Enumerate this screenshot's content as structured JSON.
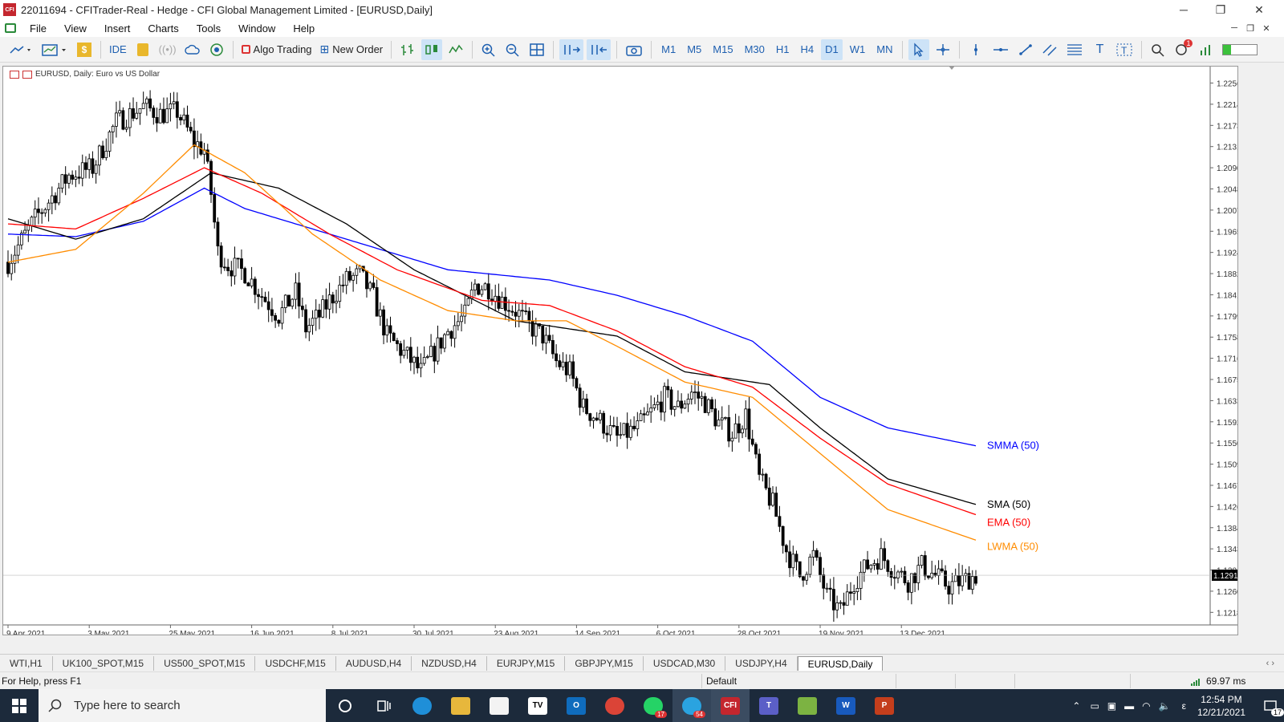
{
  "window": {
    "title": "22011694 - CFITrader-Real - Hedge - CFI Global Management Limited - [EURUSD,Daily]",
    "app_icon": "CFI",
    "controls": [
      "─",
      "❐",
      "✕"
    ]
  },
  "menu": [
    "File",
    "View",
    "Insert",
    "Charts",
    "Tools",
    "Window",
    "Help"
  ],
  "mdi_controls": [
    "─",
    "❐",
    "✕"
  ],
  "toolbar": {
    "ide": "IDE",
    "algo_trading": "Algo Trading",
    "new_order": "New Order",
    "timeframes": [
      "M1",
      "M5",
      "M15",
      "M30",
      "H1",
      "H4",
      "D1",
      "W1",
      "MN"
    ],
    "active_timeframe": "D1",
    "alert_count": "1"
  },
  "chart": {
    "header": "EURUSD, Daily:  Euro vs US Dollar",
    "price_labels": [
      "1.22560",
      "1.22145",
      "1.21730",
      "1.21315",
      "1.20900",
      "1.20485",
      "1.20070",
      "1.19655",
      "1.19240",
      "1.18825",
      "1.18410",
      "1.17995",
      "1.17580",
      "1.17165",
      "1.16750",
      "1.16335",
      "1.15920",
      "1.15505",
      "1.15090",
      "1.14675",
      "1.14260",
      "1.13845",
      "1.13430",
      "1.13015",
      "1.12600",
      "1.12185"
    ],
    "current_price": "1.12913",
    "date_labels": [
      "9 Apr 2021",
      "3 May 2021",
      "25 May 2021",
      "16 Jun 2021",
      "8 Jul 2021",
      "30 Jul 2021",
      "23 Aug 2021",
      "14 Sep 2021",
      "6 Oct 2021",
      "28 Oct 2021",
      "19 Nov 2021",
      "13 Dec 2021"
    ],
    "indicators": [
      {
        "label": "SMMA (50)",
        "color": "#0000ff"
      },
      {
        "label": "SMA (50)",
        "color": "#000000"
      },
      {
        "label": "EMA (50)",
        "color": "#ff0000"
      },
      {
        "label": "LWMA (50)",
        "color": "#ff8c00"
      }
    ]
  },
  "chart_data": {
    "type": "candlestick",
    "title": "EURUSD, Daily:  Euro vs US Dollar",
    "y_range": [
      1.1197,
      1.2282
    ],
    "x_ticks": [
      "9 Apr 2021",
      "3 May 2021",
      "25 May 2021",
      "16 Jun 2021",
      "8 Jul 2021",
      "30 Jul 2021",
      "23 Aug 2021",
      "14 Sep 2021",
      "6 Oct 2021",
      "28 Oct 2021",
      "19 Nov 2021",
      "13 Dec 2021"
    ],
    "close_path": [
      [
        0,
        1.1905
      ],
      [
        8,
        1.199
      ],
      [
        18,
        1.2075
      ],
      [
        25,
        1.209
      ],
      [
        32,
        1.218
      ],
      [
        40,
        1.221
      ],
      [
        45,
        1.2195
      ],
      [
        50,
        1.22
      ],
      [
        55,
        1.214
      ],
      [
        58,
        1.2125
      ],
      [
        60,
        1.204
      ],
      [
        62,
        1.1925
      ],
      [
        65,
        1.19
      ],
      [
        70,
        1.1885
      ],
      [
        75,
        1.184
      ],
      [
        80,
        1.18
      ],
      [
        85,
        1.1845
      ],
      [
        88,
        1.1775
      ],
      [
        92,
        1.18
      ],
      [
        95,
        1.183
      ],
      [
        100,
        1.187
      ],
      [
        104,
        1.188
      ],
      [
        108,
        1.1835
      ],
      [
        112,
        1.176
      ],
      [
        118,
        1.172
      ],
      [
        122,
        1.169
      ],
      [
        126,
        1.173
      ],
      [
        130,
        1.177
      ],
      [
        135,
        1.18
      ],
      [
        138,
        1.186
      ],
      [
        142,
        1.1855
      ],
      [
        146,
        1.183
      ],
      [
        150,
        1.181
      ],
      [
        154,
        1.178
      ],
      [
        158,
        1.176
      ],
      [
        162,
        1.171
      ],
      [
        166,
        1.169
      ],
      [
        170,
        1.162
      ],
      [
        174,
        1.16
      ],
      [
        180,
        1.156
      ],
      [
        186,
        1.158
      ],
      [
        190,
        1.161
      ],
      [
        194,
        1.164
      ],
      [
        198,
        1.162
      ],
      [
        202,
        1.165
      ],
      [
        206,
        1.163
      ],
      [
        210,
        1.159
      ],
      [
        214,
        1.157
      ],
      [
        218,
        1.1605
      ],
      [
        222,
        1.148
      ],
      [
        226,
        1.143
      ],
      [
        230,
        1.134
      ],
      [
        234,
        1.129
      ],
      [
        238,
        1.133
      ],
      [
        242,
        1.125
      ],
      [
        246,
        1.122
      ],
      [
        250,
        1.128
      ],
      [
        254,
        1.131
      ],
      [
        258,
        1.133
      ],
      [
        262,
        1.13
      ],
      [
        266,
        1.128
      ],
      [
        270,
        1.131
      ],
      [
        274,
        1.129
      ],
      [
        278,
        1.127
      ],
      [
        282,
        1.128
      ],
      [
        286,
        1.1291
      ]
    ],
    "series": [
      {
        "name": "SMMA (50)",
        "color": "#0000ff",
        "points": [
          [
            0,
            1.196
          ],
          [
            20,
            1.1955
          ],
          [
            40,
            1.1985
          ],
          [
            58,
            1.205
          ],
          [
            70,
            1.201
          ],
          [
            90,
            1.197
          ],
          [
            110,
            1.193
          ],
          [
            130,
            1.189
          ],
          [
            160,
            1.187
          ],
          [
            180,
            1.184
          ],
          [
            200,
            1.18
          ],
          [
            220,
            1.175
          ],
          [
            240,
            1.164
          ],
          [
            260,
            1.158
          ],
          [
            286,
            1.1545
          ]
        ]
      },
      {
        "name": "SMA (50)",
        "color": "#000000",
        "points": [
          [
            0,
            1.199
          ],
          [
            20,
            1.195
          ],
          [
            40,
            1.199
          ],
          [
            60,
            1.208
          ],
          [
            80,
            1.205
          ],
          [
            100,
            1.198
          ],
          [
            120,
            1.189
          ],
          [
            150,
            1.179
          ],
          [
            180,
            1.176
          ],
          [
            200,
            1.169
          ],
          [
            225,
            1.1665
          ],
          [
            240,
            1.158
          ],
          [
            260,
            1.148
          ],
          [
            286,
            1.143
          ]
        ]
      },
      {
        "name": "EMA (50)",
        "color": "#ff0000",
        "points": [
          [
            0,
            1.198
          ],
          [
            20,
            1.197
          ],
          [
            40,
            1.203
          ],
          [
            58,
            1.209
          ],
          [
            75,
            1.204
          ],
          [
            95,
            1.196
          ],
          [
            115,
            1.189
          ],
          [
            140,
            1.183
          ],
          [
            160,
            1.182
          ],
          [
            180,
            1.177
          ],
          [
            200,
            1.17
          ],
          [
            220,
            1.166
          ],
          [
            240,
            1.156
          ],
          [
            260,
            1.147
          ],
          [
            286,
            1.141
          ]
        ]
      },
      {
        "name": "LWMA (50)",
        "color": "#ff8c00",
        "points": [
          [
            0,
            1.1905
          ],
          [
            20,
            1.193
          ],
          [
            40,
            1.204
          ],
          [
            55,
            1.2135
          ],
          [
            70,
            1.208
          ],
          [
            90,
            1.196
          ],
          [
            110,
            1.187
          ],
          [
            130,
            1.181
          ],
          [
            150,
            1.179
          ],
          [
            165,
            1.179
          ],
          [
            180,
            1.174
          ],
          [
            200,
            1.167
          ],
          [
            220,
            1.164
          ],
          [
            240,
            1.153
          ],
          [
            260,
            1.142
          ],
          [
            286,
            1.136
          ]
        ]
      }
    ]
  },
  "tabs": [
    "WTI,H1",
    "UK100_SPOT,M15",
    "US500_SPOT,M15",
    "USDCHF,M15",
    "AUDUSD,H4",
    "NZDUSD,H4",
    "EURJPY,M15",
    "GBPJPY,M15",
    "USDCAD,M30",
    "USDJPY,H4",
    "EURUSD,Daily"
  ],
  "active_tab": "EURUSD,Daily",
  "status": {
    "help": "For Help, press F1",
    "profile": "Default",
    "ping": "69.97 ms"
  },
  "taskbar": {
    "search_placeholder": "Type here to search",
    "time": "12:54 PM",
    "date": "12/21/2021",
    "notif_count": "17",
    "whatsapp_badge": "17",
    "telegram_badge": "54",
    "lang": "ε"
  }
}
